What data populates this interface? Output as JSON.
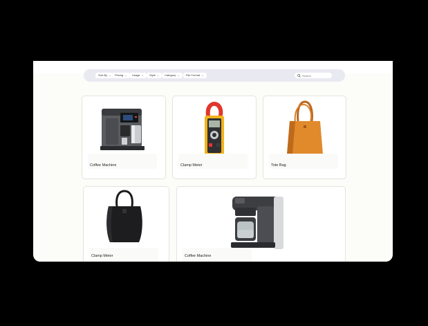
{
  "filters": [
    {
      "label": "Sort By"
    },
    {
      "label": "Pricing"
    },
    {
      "label": "Usage"
    },
    {
      "label": "Style"
    },
    {
      "label": "Category"
    },
    {
      "label": "File Format"
    }
  ],
  "search": {
    "placeholder": "Search"
  },
  "products": [
    {
      "name": "Coffee Machine",
      "icon": "coffee-machine-image"
    },
    {
      "name": "Clamp Meter",
      "icon": "clamp-meter-image"
    },
    {
      "name": "Tote Bag",
      "icon": "tote-bag-image"
    },
    {
      "name": "Clamp Meter",
      "icon": "black-bag-image"
    },
    {
      "name": "Coffee Machine",
      "icon": "coffee-maker-image"
    }
  ]
}
